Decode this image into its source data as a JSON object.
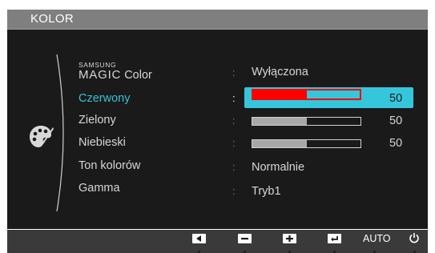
{
  "osd": {
    "title": "KOLOR",
    "menu": [
      {
        "id": "magic-color",
        "label_small": "SAMSUNG",
        "label_big": "MAGIC",
        "label_word": "Color",
        "value": "Wyłączona"
      },
      {
        "id": "red",
        "label": "Czerwony",
        "value": 50,
        "selected": true
      },
      {
        "id": "green",
        "label": "Zielony",
        "value": 50
      },
      {
        "id": "blue",
        "label": "Niebieski",
        "value": 50
      },
      {
        "id": "color-tone",
        "label": "Ton kolorów",
        "value": "Normalnie"
      },
      {
        "id": "gamma",
        "label": "Gamma",
        "value": "Tryb1"
      }
    ],
    "colon": ":",
    "slider_fill_fraction": 0.5,
    "colors": {
      "highlight": "#35c6dc",
      "selected_text": "#36c3d6",
      "red_slider": "#ff0000"
    }
  },
  "footer": {
    "buttons": [
      {
        "id": "left",
        "icon": "left-arrow-icon"
      },
      {
        "id": "minus",
        "icon": "minus-icon"
      },
      {
        "id": "plus",
        "icon": "plus-icon"
      },
      {
        "id": "enter",
        "icon": "enter-icon"
      },
      {
        "id": "auto",
        "label": "AUTO"
      },
      {
        "id": "power",
        "icon": "power-icon"
      }
    ]
  }
}
